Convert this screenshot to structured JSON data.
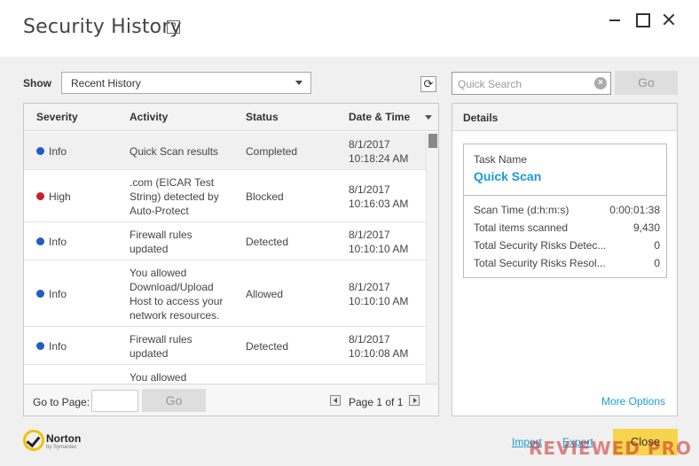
{
  "window": {
    "title": "Security History",
    "help_label": "?"
  },
  "filter": {
    "show_label": "Show",
    "selected": "Recent History"
  },
  "search": {
    "placeholder": "Quick Search",
    "go_label": "Go"
  },
  "table": {
    "columns": [
      "Severity",
      "Activity",
      "Status",
      "Date & Time"
    ],
    "rows": [
      {
        "severity": "Info",
        "activity": [
          "Quick Scan results"
        ],
        "status": "Completed",
        "date": "8/1/2017",
        "time": "10:18:24 AM"
      },
      {
        "severity": "High",
        "activity": [
          ".com (EICAR Test",
          "String) detected by",
          "Auto-Protect"
        ],
        "status": "Blocked",
        "date": "8/1/2017",
        "time": "10:16:03 AM"
      },
      {
        "severity": "Info",
        "activity": [
          "Firewall rules",
          "updated"
        ],
        "status": "Detected",
        "date": "8/1/2017",
        "time": "10:10:10 AM"
      },
      {
        "severity": "Info",
        "activity": [
          "You allowed",
          "Download/Upload",
          "Host to access your",
          "network resources."
        ],
        "status": "Allowed",
        "date": "8/1/2017",
        "time": "10:10:10 AM"
      },
      {
        "severity": "Info",
        "activity": [
          "Firewall rules",
          "updated"
        ],
        "status": "Detected",
        "date": "8/1/2017",
        "time": "10:10:08 AM"
      },
      {
        "severity": "",
        "activity": [
          "You allowed"
        ],
        "status": "",
        "date": "",
        "time": ""
      }
    ],
    "severity_colors": {
      "Info": "#1f5fbf",
      "High": "#c8202a"
    }
  },
  "pagination": {
    "goto_label": "Go to Page:",
    "go_label": "Go",
    "page_info": "Page 1 of 1"
  },
  "details": {
    "header": "Details",
    "task_label": "Task Name",
    "task_name": "Quick Scan",
    "stats": [
      {
        "label": "Scan Time (d:h:m:s)",
        "value": "0:00:01:38"
      },
      {
        "label": "Total items scanned",
        "value": "9,430"
      },
      {
        "label": "Total Security Risks Detec...",
        "value": "0"
      },
      {
        "label": "Total Security Risks Resol...",
        "value": "0"
      }
    ],
    "more_options": "More Options"
  },
  "footer": {
    "brand": "Norton",
    "brand_sub": "by Symantec",
    "import_label": "Import",
    "export_label": "Export",
    "close_label": "Close",
    "watermark": "REVIEWED PRO"
  },
  "colors": {
    "accent": "#1a9ad6",
    "close_button": "#f7d44c"
  }
}
